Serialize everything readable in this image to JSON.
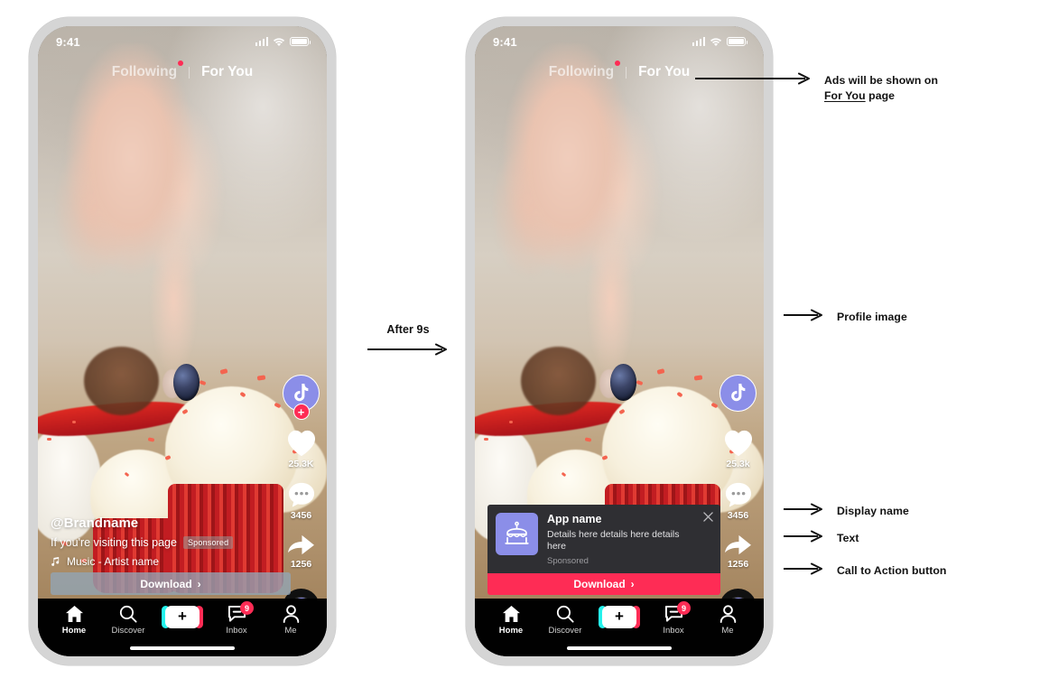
{
  "phones": [
    {
      "id": "phone-before",
      "statusbar": {
        "time": "9:41",
        "signal_icon": "cellular-bars-icon",
        "wifi_icon": "wifi-icon",
        "battery_icon": "battery-icon"
      },
      "tabs": {
        "following": "Following",
        "for_you": "For You",
        "active": "For You"
      },
      "rail": {
        "avatar_icon": "tiktok-note-icon",
        "follow_plus": "+",
        "like_icon": "heart-icon",
        "like_count": "25.3K",
        "comment_icon": "comment-icon",
        "comment_count": "3456",
        "share_icon": "share-arrow-icon",
        "share_count": "1256",
        "disc_icon": "music-disc-icon"
      },
      "caption": {
        "handle": "@Brandname",
        "description": "If you're visiting this page",
        "sponsored_tag": "Sponsored",
        "music_icon": "music-note-icon",
        "music": "Music - Artist name"
      },
      "cta": {
        "label": "Download",
        "chevron": "›",
        "style": "ghost"
      }
    },
    {
      "id": "phone-after",
      "statusbar": {
        "time": "9:41",
        "signal_icon": "cellular-bars-icon",
        "wifi_icon": "wifi-icon",
        "battery_icon": "battery-icon"
      },
      "tabs": {
        "following": "Following",
        "for_you": "For You",
        "active": "For You"
      },
      "rail": {
        "avatar_icon": "tiktok-note-icon",
        "like_icon": "heart-icon",
        "like_count": "25.3k",
        "comment_icon": "comment-icon",
        "comment_count": "3456",
        "share_icon": "share-arrow-icon",
        "share_count": "1256",
        "disc_icon": "music-disc-icon"
      },
      "ad_card": {
        "app_icon": "cake-icon",
        "app_name": "App name",
        "details": "Details here details here details here",
        "sponsored": "Sponsored",
        "close_icon": "close-icon",
        "cta_label": "Download",
        "cta_chevron": "›"
      }
    }
  ],
  "bottom_nav": {
    "items": [
      {
        "label": "Home",
        "icon": "home-icon",
        "active": true
      },
      {
        "label": "Discover",
        "icon": "search-icon",
        "active": false
      },
      {
        "label": "",
        "icon": "create-plus-icon",
        "active": false
      },
      {
        "label": "Inbox",
        "icon": "inbox-icon",
        "active": false,
        "badge": "9"
      },
      {
        "label": "Me",
        "icon": "person-icon",
        "active": false
      }
    ],
    "plus_glyph": "+"
  },
  "transition": {
    "label": "After 9s",
    "arrow_icon": "arrow-right-icon"
  },
  "annotations": [
    {
      "id": "annotation-for-you",
      "line1_pre": "Ads will be shown on",
      "line2_underlined": "For You",
      "line2_post": " page"
    },
    {
      "id": "annotation-profile-image",
      "text": "Profile image"
    },
    {
      "id": "annotation-display-name",
      "text": "Display name"
    },
    {
      "id": "annotation-text",
      "text": "Text"
    },
    {
      "id": "annotation-cta",
      "text": "Call to Action button"
    }
  ],
  "colors": {
    "tiktok_pink": "#FE2C55",
    "tiktok_cyan": "#25F4EE",
    "periwinkle": "#8B8EE8",
    "ad_card_bg": "#2F2F33",
    "ghost_cta": "#92A5B6",
    "phone_bezel": "#D5D5D5"
  }
}
